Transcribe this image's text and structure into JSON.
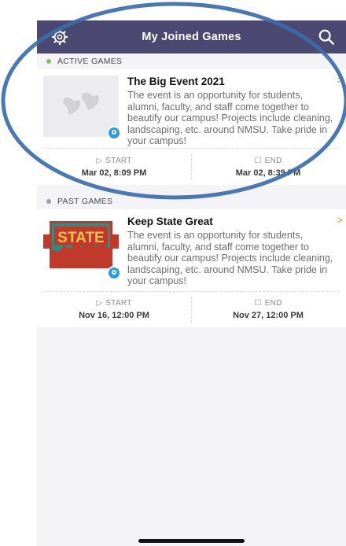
{
  "header": {
    "title": "My Joined Games"
  },
  "sections": {
    "active": "ACTIVE GAMES",
    "past": "PAST GAMES"
  },
  "games": [
    {
      "title": "The Big Event 2021",
      "description": "The event is an opportunity for students, alumni, faculty, and staff come together to beautify our campus! Projects include cleaning, landscaping, etc. around NMSU. Take pride in your campus!",
      "start_label": "START",
      "start": "Mar 02, 8:09 PM",
      "end_label": "END",
      "end": "Mar 02, 8:39 PM"
    },
    {
      "title": "Keep State Great",
      "description": "The event is an opportunity for students, alumni, faculty, and staff come together to beautify our campus! Projects include cleaning, landscaping, etc. around NMSU. Take pride in your campus!",
      "logo_text": "STATE",
      "start_label": "START",
      "start": "Nov 16, 12:00 PM",
      "end_label": "END",
      "end": "Nov 27, 12:00 PM"
    }
  ],
  "colors": {
    "header_bg": "#4b4871",
    "active_dot": "#7cc05a",
    "past_dot": "#a0a0a0",
    "accent_orange": "#f08a24",
    "pin_blue": "#2d9be0",
    "annotation_oval": "#3a6cab"
  }
}
